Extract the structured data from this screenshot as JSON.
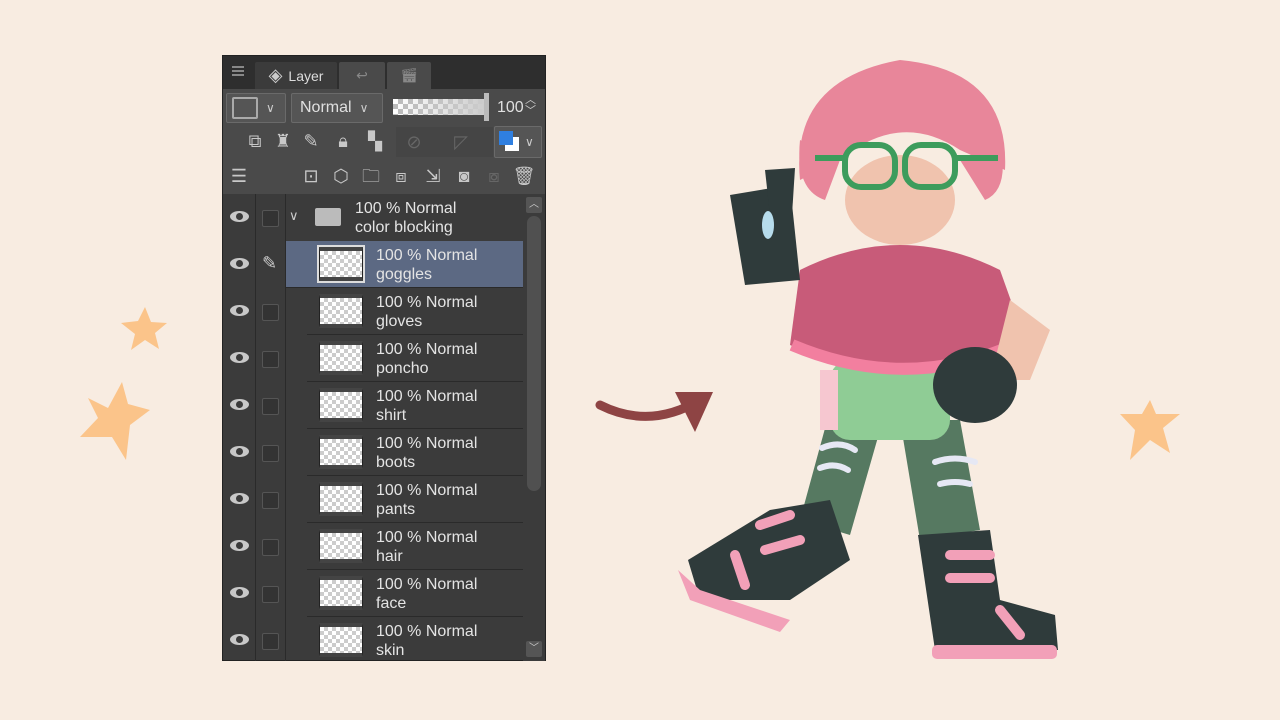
{
  "panel": {
    "tab_label": "Layer",
    "blend_mode": "Normal",
    "opacity": "100",
    "main_color": "#2f7fe0"
  },
  "group": {
    "opacity_mode": "100 % Normal",
    "name": "color blocking"
  },
  "layers": [
    {
      "opacity_mode": "100 % Normal",
      "name": "goggles",
      "selected": true
    },
    {
      "opacity_mode": "100 % Normal",
      "name": "gloves"
    },
    {
      "opacity_mode": "100 % Normal",
      "name": "poncho"
    },
    {
      "opacity_mode": "100 % Normal",
      "name": "shirt"
    },
    {
      "opacity_mode": "100 % Normal",
      "name": "boots"
    },
    {
      "opacity_mode": "100 % Normal",
      "name": "pants"
    },
    {
      "opacity_mode": "100 % Normal",
      "name": "hair"
    },
    {
      "opacity_mode": "100 % Normal",
      "name": "face"
    },
    {
      "opacity_mode": "100 % Normal",
      "name": "skin"
    }
  ]
}
